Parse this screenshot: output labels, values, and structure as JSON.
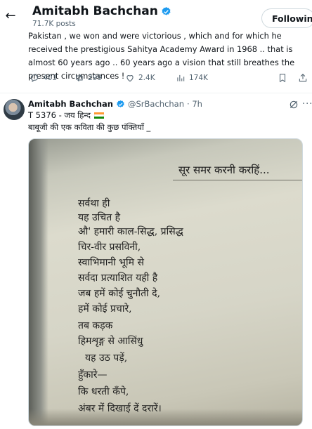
{
  "header": {
    "name": "Amitabh Bachchan",
    "post_count": "71.7K posts",
    "follow_label": "Following"
  },
  "quoted_text": "Pakistan , we won and were victorious , which and for which he received the prestigious Sahitya Academy Award in 1968 .. that is almost 60 years ago .. 60 years ago a vision that still breathes the present circumstances  !",
  "actions": {
    "replies": "403",
    "reposts": "299",
    "likes": "2.4K",
    "views": "174K"
  },
  "tweet": {
    "name": "Amitabh Bachchan",
    "handle": "@SrBachchan",
    "time": "· 7h",
    "line1": "T 5376 - जय हिन्द",
    "line2": "बाबूजी की एक कविता की कुछ पंक्तियाँ _"
  },
  "poem": {
    "title": "सूर समर करनी करहिं...",
    "lines": [
      "सर्वथा ही",
      "यह उचित है",
      "औ' हमारी काल-सिद्ध, प्रसिद्ध",
      "चिर-वीर प्रसविनी,",
      "स्वाभिमानी भूमि से",
      "सर्वदा प्रत्याशित यही है",
      "जब हमें कोई चुनौती दे,",
      "हमें कोई प्रचारे,",
      "तब कड़क",
      "हिमशृङ्ग से आसिंधु",
      "यह उठ पड़ें,",
      "हुँकारे—",
      "कि धरती कँपे,",
      "अंबर में दिखाई दें दरारें।"
    ]
  },
  "colors": {
    "verified": "#1d9bf0",
    "muted": "#536471",
    "text": "#0f1419"
  },
  "icons": [
    "back-arrow-icon",
    "verified-badge-icon",
    "reply-icon",
    "repost-icon",
    "like-icon",
    "views-icon",
    "bookmark-icon",
    "share-icon",
    "grok-icon",
    "more-icon",
    "india-flag-icon"
  ]
}
